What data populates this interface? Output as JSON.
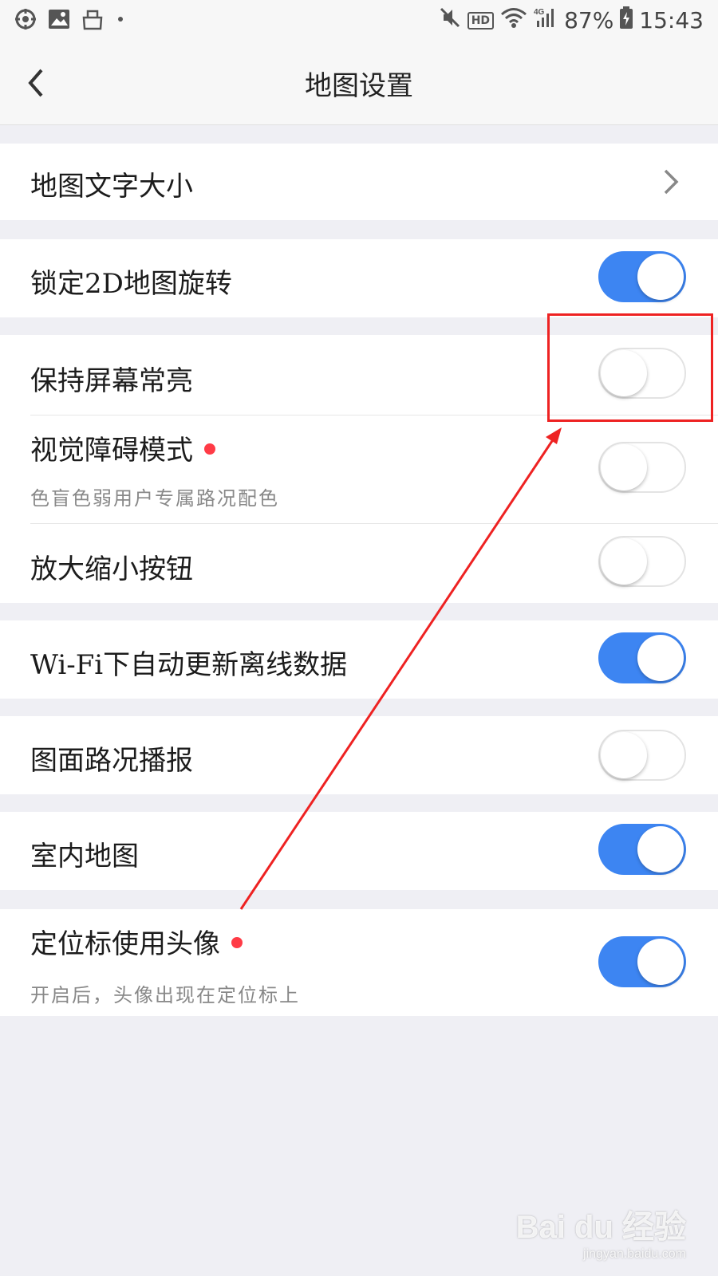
{
  "status_bar": {
    "battery": "87%",
    "time": "15:43",
    "hd": "HD",
    "left_icons": [
      "location-target-icon",
      "image-icon",
      "bag-icon",
      "dot-icon"
    ],
    "right_icons": [
      "mute-icon",
      "hd-icon",
      "wifi-icon",
      "signal-4g-icon",
      "battery-icon"
    ]
  },
  "header": {
    "title": "地图设置",
    "back_icon": "chevron-left-icon"
  },
  "settings": {
    "font_size": {
      "label": "地图文字大小",
      "icon": "chevron-right-icon"
    },
    "lock_2d_rotation": {
      "label": "锁定2D地图旋转",
      "enabled": true
    },
    "keep_screen_on": {
      "label": "保持屏幕常亮",
      "enabled": false
    },
    "accessibility_mode": {
      "label": "视觉障碍模式",
      "sub": "色盲色弱用户专属路况配色",
      "enabled": false,
      "new_dot": true
    },
    "zoom_buttons": {
      "label": "放大缩小按钮",
      "enabled": false
    },
    "wifi_auto_update": {
      "label": "Wi-Fi下自动更新离线数据",
      "enabled": true
    },
    "traffic_broadcast": {
      "label": "图面路况播报",
      "enabled": false
    },
    "indoor_map": {
      "label": "室内地图",
      "enabled": true
    },
    "avatar_location_marker": {
      "label": "定位标使用头像",
      "sub": "开启后，头像出现在定位标上",
      "enabled": true,
      "new_dot": true
    }
  },
  "colors": {
    "toggle_on": "#3d85f2",
    "new_dot": "#ff3b46",
    "annotation": "#ee2222"
  },
  "watermark": {
    "main": "Bai du 经验",
    "sub": "jingyan.baidu.com"
  }
}
